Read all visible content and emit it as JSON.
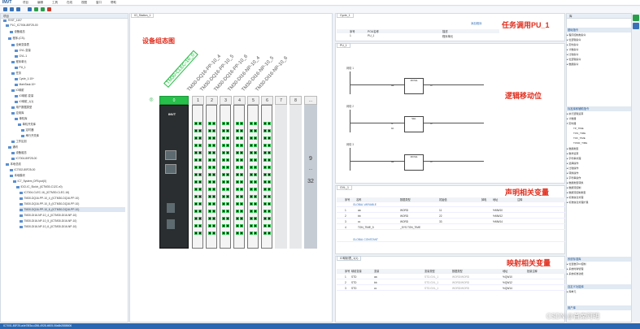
{
  "app": {
    "logo": "INVT"
  },
  "menu": [
    "项目",
    "编辑",
    "工具",
    "在线",
    "视图",
    "窗口",
    "帮助"
  ],
  "tree": {
    "title": "项目",
    "rows": [
      "TEST_1107",
      "PLC_IC7004-80F25-00",
      "设备组态",
      "程序-(CS)-",
      "全局变量表",
      "GVL-变量",
      "GVL-1",
      "程序单元",
      "PU_1",
      "任务",
      "Cycle_1:10+",
      "MainTask:10+",
      "IO映射",
      "IO映射-变量",
      "IO映射_1(1)",
      "用户数据类型",
      "应用库",
      "单机库",
      "单机开关库",
      "定时器",
      "串行开关库",
      "工作区划",
      "通讯",
      "设备组态",
      "IC7004-80F25-00",
      "本地总线",
      "IC7002-80F25-00",
      "本地模块",
      "IC7_System_DF5.put(0)",
      "IDCI-IC_SloIdr_(ICTM30-C12C.v0)",
      "IC7004-CLEC-16_(ICTM30-CLEC-16)",
      "TM30-DQ16-PP-10_4_(ICTM30-DQ16-PP-10)",
      "TM30-DQ16-PP-10_5_(ICTM30-DQ16-PP-10)",
      "TM30-DQ16-PP-10_6_(ICTM30-DQ16-PP-10)",
      "TM30-DI16-NP-10_4_(ICTM30-DI16-NP-10)",
      "TM30-DI16-NP-10_5_(ICTM30-DI16-NP-10)",
      "TM30-DI16-NP-10_6_(ICTM30-DI16-NP-10)"
    ]
  },
  "device": {
    "tab": "IO_Station_1",
    "annotation": "设备组态图",
    "head_label": "TM30-CLEC-16_0",
    "module_labels": [
      "TM30-DQ16-PP-10_4",
      "TM30-DQ16-PP-10_5",
      "TM30-DQ16-PP-10_6",
      "TM30-DI16-NP-10_4",
      "TM30-DI16-NP-10_5",
      "TM30-DI16-NP-10_6"
    ],
    "slots": [
      "0",
      "1",
      "2",
      "3",
      "4",
      "5",
      "6",
      "7",
      "8",
      "..."
    ],
    "right_top": "9",
    "right_dots": "...",
    "right_bottom": "32"
  },
  "task": {
    "tab": "Cycle_1",
    "annotation": "任务调用PU_1",
    "add_label": "添加程序",
    "headers": [
      "序号",
      "POU名称",
      "描述"
    ],
    "row": [
      "1",
      "PU_1",
      "程序单元"
    ]
  },
  "pou": {
    "tab": "PU_1",
    "annotation": "逻辑移动位",
    "networks": [
      "网络 1",
      "网络 2",
      "网络 3"
    ],
    "blocks": [
      "MOVE",
      "SEL",
      "MOVE"
    ],
    "vars": [
      [
        "aa",
        "bb",
        "cc"
      ],
      [
        "G",
        "bb",
        "cc"
      ],
      [
        "aa",
        "bb",
        "cc"
      ]
    ]
  },
  "gvl": {
    "tab": "GVL_1",
    "annotation": "声明相关变量",
    "headers": [
      "序号",
      "名称",
      "数据类型",
      "初始值",
      "掉电",
      "地址",
      "注释"
    ],
    "group1": "GLOBAL VARIABLE",
    "rows": [
      [
        "1",
        "aa",
        "WORD",
        "11",
        "",
        "%MW10",
        ""
      ],
      [
        "2",
        "bb",
        "WORD",
        "22",
        "",
        "%MW12",
        ""
      ],
      [
        "3",
        "cc",
        "WORD",
        "33",
        "",
        "%MW14",
        ""
      ],
      [
        "4",
        "TON_TIME_5",
        "_SYS.TON_TIME",
        "",
        "",
        "",
        ""
      ]
    ],
    "group2": "GLOBAL CONSTANT"
  },
  "iomap": {
    "tab": "IO映射表_1(1)",
    "annotation": "映射相关变量",
    "headers": [
      "序号",
      "映射变量",
      "变量",
      "变量类型",
      "数据类型",
      "地址",
      "批量注释"
    ],
    "rows": [
      [
        "1",
        "STD",
        "aa",
        "STD.GVL_1",
        "WORD/WORD",
        "%QW10"
      ],
      [
        "2",
        "STD",
        "bb",
        "STD.GVL_1",
        "WORD/WORD",
        "%QW12"
      ],
      [
        "3",
        "STD",
        "cc",
        "STD.GVL_1",
        "WORD/WORD",
        "%QW14"
      ]
    ]
  },
  "library": {
    "title": "库",
    "sec1": "基础指令",
    "items1": [
      "程序控制类指令",
      "位逻辑指令",
      "定时指令",
      "计数指令",
      "比较指令",
      "位逻辑指令",
      "数据指令"
    ],
    "sec2": "标准库和辅助指令",
    "items2": [
      "执行逻辑运算",
      "计数器",
      "定时器",
      "TP_TIME",
      "TON_TIME",
      "TOF_TIME",
      "TONR_TIME",
      "数据类型",
      "数学运算",
      "字符串处理",
      "选择操作",
      "比较操作",
      "转换操作",
      "字符串操作",
      "数据类型转换",
      "数据流控制",
      "数据流控制类型",
      "标准信息处理",
      "标准信息处理扩展"
    ],
    "sec3": "系统标准库",
    "items3": [
      "位置数字IO控制",
      "系统时钟管理",
      "系统标准功能"
    ],
    "sec4": "自定义功能库",
    "items4": [
      "库单元"
    ],
    "sec5": "用户库"
  },
  "status": "IC7001-80F25-a4e78f3a-c286-4928-b505-06a6b2888606",
  "watermark": "CSDN @首席阿明"
}
